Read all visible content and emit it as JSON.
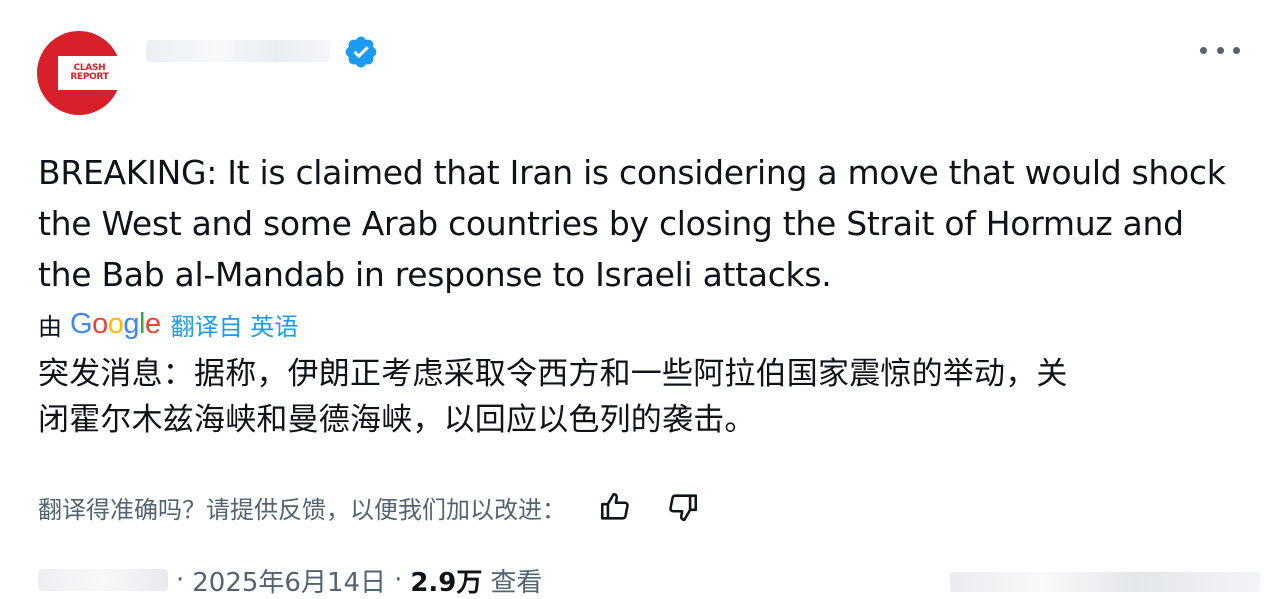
{
  "header": {
    "avatar_text_line1": "CLASH",
    "avatar_text_line2": "REPORT",
    "verified_icon": "verified-badge-icon",
    "more_icon": "more-horizontal-icon"
  },
  "tweet": {
    "lines": [
      "BREAKING: It is claimed that Iran is considering a move that would shock",
      "the West and some Arab countries by closing the Strait of Hormuz and",
      "the Bab al-Mandab in response to Israeli attacks."
    ]
  },
  "translation": {
    "by_label": "由",
    "google_label": "Google",
    "translated_from": "翻译自 英语",
    "lines": [
      "突发消息：据称，伊朗正考虑采取令西方和一些阿拉伯国家震惊的举动，关",
      "闭霍尔木兹海峡和曼德海峡，以回应以色列的袭击。"
    ]
  },
  "feedback": {
    "prompt": "翻译得准确吗？请提供反馈，以便我们加以改进：",
    "thumbs_up_icon": "thumbs-up-icon",
    "thumbs_down_icon": "thumbs-down-icon"
  },
  "meta": {
    "date": "2025年6月14日",
    "views_count": "2.9万",
    "views_label": "查看",
    "separator": "·"
  },
  "colors": {
    "accent": "#1d9bf0",
    "brand_red": "#d8202a",
    "text": "#0f1419",
    "secondary_text": "#536471"
  }
}
